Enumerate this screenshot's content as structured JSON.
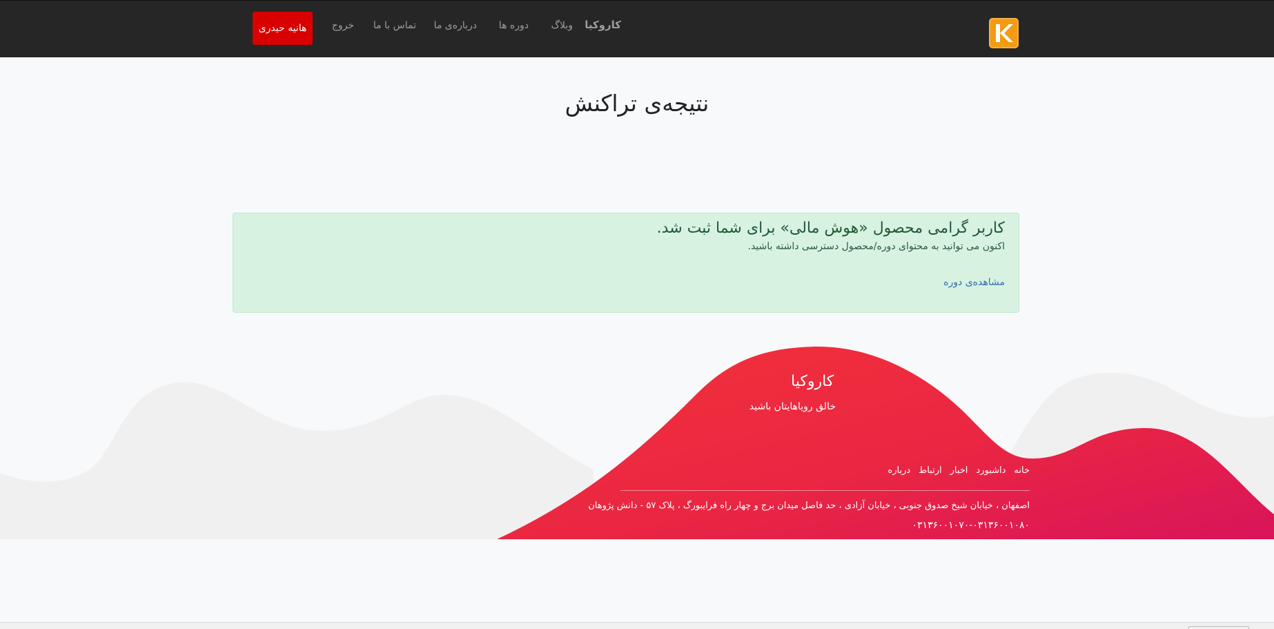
{
  "navbar": {
    "brand": "کاروکیا",
    "items": [
      "وبلاگ",
      "دوره ها",
      "درباره‌ی ما",
      "تماس با ما",
      "خروج"
    ],
    "user_button": "هانیه حیدری",
    "logo_icon": "k-logo-icon",
    "colors": {
      "background": "#262626",
      "user_button": "#d80000",
      "logo": "#f39b12"
    }
  },
  "page": {
    "title": "نتیجه‌ی تراکنش"
  },
  "alert": {
    "heading": "کاربر گرامی محصول «هوش مالی» برای شما ثبت شد.",
    "text": "اکنون می توانید به محتوای دوره/محصول دسترسی داشته باشید.",
    "link": "مشاهده‌ی دوره",
    "colors": {
      "background": "#d8f2e2",
      "text": "#1e5a32",
      "link": "#2f6fad"
    }
  },
  "footer": {
    "brand": "کاروکیا",
    "tagline": "خالق رویاهایتان باشید",
    "links": [
      "خانه",
      "داشبورد",
      "اخبار",
      "ارتباط",
      "درباره"
    ],
    "address": "اصفهان ، خیابان شیخ صدوق جنوبی ، خیابان آزادی ، حد فاصل میدان برج و چهار راه فرایبورگ ، پلاک ۵۷ - دانش پژوهان",
    "phone": "۰۳۱۳۶۰۰۱۰۷۰-۰۳۱۳۶۰۰۱۰۸۰",
    "colors": {
      "wave_start": "#f2323a",
      "wave_end": "#d9145a",
      "background_wave": "#f0f0f0"
    }
  }
}
